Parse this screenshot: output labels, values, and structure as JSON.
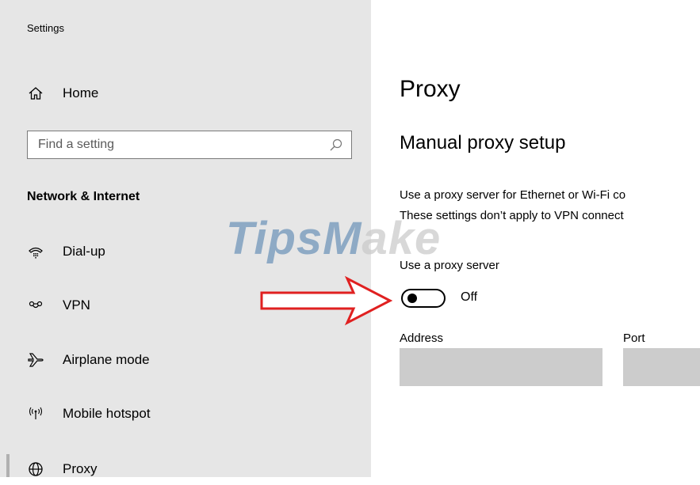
{
  "window": {
    "title": "Settings"
  },
  "sidebar": {
    "home_label": "Home",
    "search": {
      "placeholder": "Find a setting"
    },
    "section_heading": "Network & Internet",
    "items": [
      {
        "label": "Dial-up",
        "icon": "dial-up-icon"
      },
      {
        "label": "VPN",
        "icon": "vpn-icon"
      },
      {
        "label": "Airplane mode",
        "icon": "airplane-icon"
      },
      {
        "label": "Mobile hotspot",
        "icon": "hotspot-icon"
      },
      {
        "label": "Proxy",
        "icon": "globe-icon",
        "selected": true
      }
    ]
  },
  "main": {
    "title": "Proxy",
    "subheading": "Manual proxy setup",
    "description_line1": "Use a proxy server for Ethernet or Wi-Fi co",
    "description_line2": "These settings don’t apply to VPN connect",
    "use_proxy_label": "Use a proxy server",
    "toggle_state": "Off",
    "toggle_on": false,
    "address_label": "Address",
    "port_label": "Port",
    "address_value": "",
    "port_value": ""
  },
  "overlay": {
    "watermark_part1": "TipsM",
    "watermark_part2": "ake",
    "arrow_color": "#e02020"
  },
  "colors": {
    "sidebar_bg": "#e6e6e6",
    "input_gray": "#cccccc"
  }
}
